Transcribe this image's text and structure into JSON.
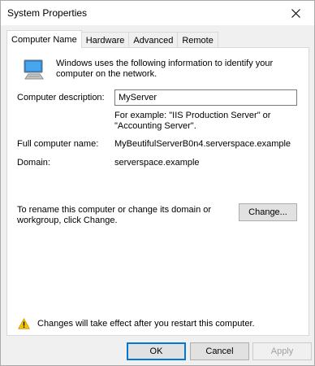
{
  "window": {
    "title": "System Properties"
  },
  "tabs": [
    {
      "label": "Computer Name",
      "active": true
    },
    {
      "label": "Hardware",
      "active": false
    },
    {
      "label": "Advanced",
      "active": false
    },
    {
      "label": "Remote",
      "active": false
    }
  ],
  "panel": {
    "intro": "Windows uses the following information to identify your computer on the network.",
    "description_label": "Computer description:",
    "description_value": "MyServer",
    "example_text": "For example: \"IIS Production Server\" or \"Accounting Server\".",
    "full_name_label": "Full computer name:",
    "full_name_value": "MyBeutifulServerB0n4.serverspace.example",
    "domain_label": "Domain:",
    "domain_value": "serverspace.example",
    "rename_text": "To rename this computer or change its domain or workgroup, click Change.",
    "change_button": "Change...",
    "warning_text": "Changes will take effect after you restart this computer."
  },
  "buttons": {
    "ok": "OK",
    "cancel": "Cancel",
    "apply": "Apply"
  },
  "icons": {
    "close": "close-icon",
    "computer": "computer-icon",
    "warning": "warning-icon"
  },
  "colors": {
    "accent": "#0078d7",
    "warning": "#f5c400",
    "monitor": "#2b88d9"
  }
}
